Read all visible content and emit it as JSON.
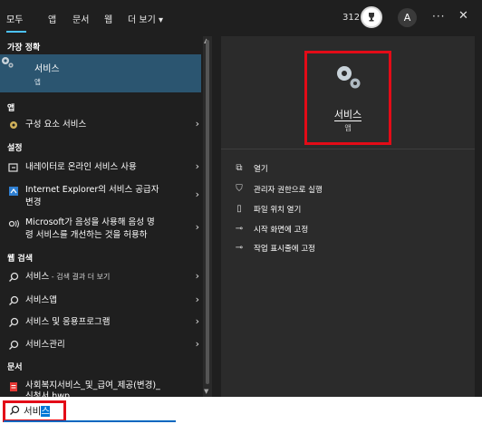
{
  "tabs": [
    "모두",
    "앱",
    "문서",
    "웹",
    "더 보기"
  ],
  "more_arrow": "▾",
  "header": {
    "count": "312",
    "avatar_letter": "A",
    "more": "···",
    "close": "✕"
  },
  "sections": {
    "best_match": "가장 정확",
    "apps": "앱",
    "settings": "설정",
    "web": "웹 검색",
    "docs": "문서"
  },
  "best_match": {
    "title": "서비스",
    "subtitle": "앱"
  },
  "apps": [
    {
      "label": "구성 요소 서비스"
    }
  ],
  "settings": [
    {
      "line1": "내레이터로 온라인 서비스 사용"
    },
    {
      "line1": "Internet Explorer의 서비스 공급자",
      "line2": "변경"
    },
    {
      "line1": "Microsoft가 음성을 사용해 음성 명",
      "line2": "령 서비스를 개선하는 것을 허용하"
    }
  ],
  "web": [
    {
      "label": "서비스",
      "suffix": " - 검색 결과 더 보기"
    },
    {
      "label": "서비스앱"
    },
    {
      "label": "서비스 및 응용프로그램"
    },
    {
      "label": "서비스관리"
    }
  ],
  "docs": [
    {
      "line1": "사회복지서비스_및_급여_제공(변경)_",
      "line2": "신청서.hwp"
    }
  ],
  "detail": {
    "title": "서비스",
    "subtitle": "앱",
    "actions": [
      "열기",
      "관리자 권한으로 실행",
      "파일 위치 열기",
      "시작 화면에 고정",
      "작업 표시줄에 고정"
    ]
  },
  "search": {
    "typed": "서비",
    "selected": "스"
  },
  "colors": {
    "accent": "#4cc2ff",
    "highlight": "#e30b17",
    "best_bg": "#2b5570"
  }
}
